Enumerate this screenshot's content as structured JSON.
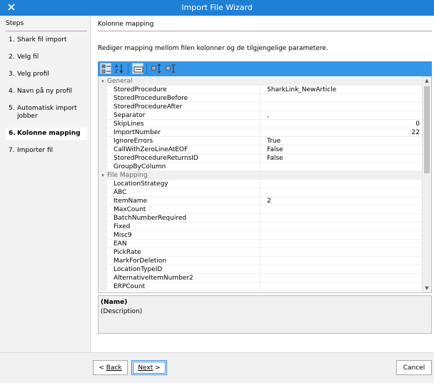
{
  "window": {
    "title": "Import File Wizard"
  },
  "steps": {
    "title": "Steps",
    "items": [
      {
        "num": "1.",
        "label": "Shark fil import"
      },
      {
        "num": "2.",
        "label": "Velg fil"
      },
      {
        "num": "3.",
        "label": "Velg profil"
      },
      {
        "num": "4.",
        "label": "Navn på ny profil"
      },
      {
        "num": "5.",
        "label": "Automatisk import jobber"
      },
      {
        "num": "6.",
        "label": "Kolonne mapping",
        "current": true
      },
      {
        "num": "7.",
        "label": "Importer fil"
      }
    ]
  },
  "main": {
    "heading": "Kolonne mapping",
    "description": "Rediger mapping mellom filen kolonner og de tilgjengelige parametere."
  },
  "toolbar": {
    "buttons": [
      {
        "name": "categorized-view-icon",
        "active": true
      },
      {
        "name": "alphabetical-sort-icon",
        "active": false
      },
      {
        "name": "property-pages-icon",
        "active": true
      },
      {
        "name": "expand-all-icon",
        "active": false
      },
      {
        "name": "collapse-all-icon",
        "active": false
      }
    ]
  },
  "grid": {
    "categories": [
      {
        "name": "General",
        "rows": [
          {
            "name": "StoredProcedure",
            "value": "SharkLink_NewArticle"
          },
          {
            "name": "StoredProcedureBefore",
            "value": ""
          },
          {
            "name": "StoredProcedureAfter",
            "value": ""
          },
          {
            "name": "Separator",
            "value": ","
          },
          {
            "name": "SkipLines",
            "value": "0",
            "numeric": true
          },
          {
            "name": "ImportNumber",
            "value": "22",
            "numeric": true
          },
          {
            "name": "IgnoreErrors",
            "value": "True"
          },
          {
            "name": "CallWithZeroLineAtEOF",
            "value": "False"
          },
          {
            "name": "StoredProcedureReturnsID",
            "value": "False"
          },
          {
            "name": "GroupByColumn",
            "value": ""
          }
        ]
      },
      {
        "name": "File Mapping",
        "rows": [
          {
            "name": "LocationStrategy",
            "value": ""
          },
          {
            "name": "ABC",
            "value": ""
          },
          {
            "name": "ItemName",
            "value": "2"
          },
          {
            "name": "MaxCount",
            "value": ""
          },
          {
            "name": "BatchNumberRequired",
            "value": ""
          },
          {
            "name": "Fixed",
            "value": ""
          },
          {
            "name": "Misc9",
            "value": ""
          },
          {
            "name": "EAN",
            "value": ""
          },
          {
            "name": "PickRate",
            "value": ""
          },
          {
            "name": "MarkForDeletion",
            "value": ""
          },
          {
            "name": "LocationTypeID",
            "value": ""
          },
          {
            "name": "AlternativeItemNumber2",
            "value": ""
          },
          {
            "name": "ERPCount",
            "value": ""
          }
        ]
      }
    ]
  },
  "help": {
    "name": "(Name)",
    "description": "(Description)"
  },
  "footer": {
    "back_label": "Back",
    "next_label": "Next",
    "cancel_label": "Cancel"
  },
  "colors": {
    "titlebar": "#1f80d6",
    "toolbar": "#3795e8",
    "selected_step_bg": "#ffffff"
  }
}
